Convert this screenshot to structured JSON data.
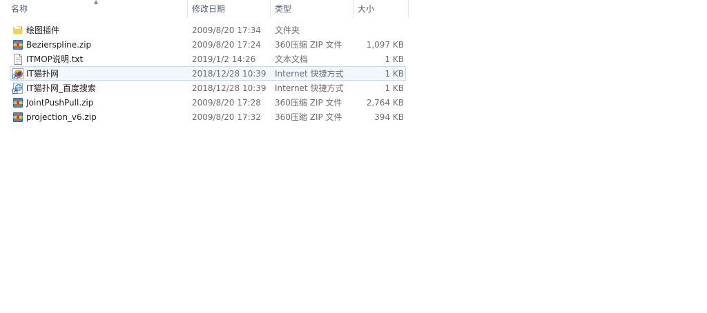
{
  "columns": {
    "name": "名称",
    "date": "修改日期",
    "type": "类型",
    "size": "大小"
  },
  "files": [
    {
      "name": "绘图插件",
      "date": "2009/8/20 17:34",
      "type": "文件夹",
      "size": "",
      "icon": "folder-icon"
    },
    {
      "name": "Bezierspline.zip",
      "date": "2009/8/20 17:24",
      "type": "360压缩 ZIP 文件",
      "size": "1,097 KB",
      "icon": "zip-archive-icon"
    },
    {
      "name": "ITMOP说明.txt",
      "date": "2019/1/2 14:26",
      "type": "文本文档",
      "size": "1 KB",
      "icon": "text-document-icon"
    },
    {
      "name": "IT猫扑网",
      "date": "2018/12/28 10:39",
      "type": "Internet 快捷方式",
      "size": "1 KB",
      "icon": "firefox-shortcut-icon"
    },
    {
      "name": "IT猫扑网_百度搜索",
      "date": "2018/12/28 10:39",
      "type": "Internet 快捷方式",
      "size": "1 KB",
      "icon": "internet-shortcut-icon"
    },
    {
      "name": "JointPushPull.zip",
      "date": "2009/8/20 17:28",
      "type": "360压缩 ZIP 文件",
      "size": "2,764 KB",
      "icon": "zip-archive-icon"
    },
    {
      "name": "projection_v6.zip",
      "date": "2009/8/20 17:32",
      "type": "360压缩 ZIP 文件",
      "size": "394 KB",
      "icon": "zip-archive-icon"
    }
  ],
  "hover_row": 3,
  "colors": {
    "header_text": "#4c607a",
    "hover_bg": "#f2f7fd",
    "hover_border": "#c4d9f2"
  }
}
